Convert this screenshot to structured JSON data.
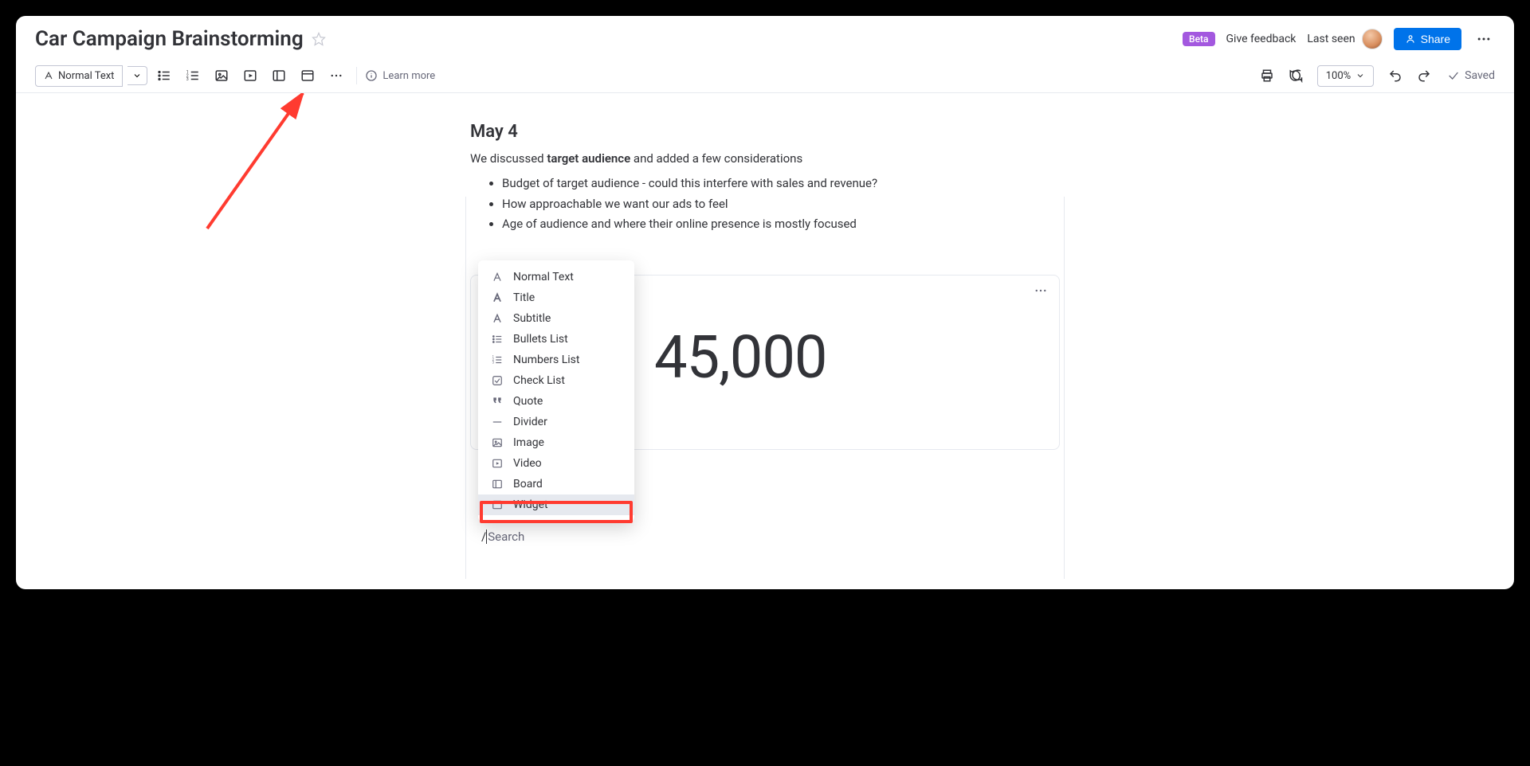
{
  "header": {
    "title": "Car Campaign Brainstorming",
    "beta_label": "Beta",
    "give_feedback": "Give feedback",
    "last_seen": "Last seen",
    "share_label": "Share"
  },
  "toolbar": {
    "text_style": "Normal Text",
    "learn_more": "Learn more",
    "zoom": "100%",
    "saved": "Saved"
  },
  "doc": {
    "date_heading": "May 4",
    "intro_prefix": "We discussed ",
    "intro_bold": "target audience",
    "intro_suffix": " and added a few considerations",
    "bullets": [
      "Budget of target audience - could this interfere with sales and revenue?",
      "How approachable we want our ads to feel",
      "Age of audience and where their online presence is mostly focused"
    ],
    "widget_value": "45,000"
  },
  "block_menu": {
    "items": [
      "Normal Text",
      "Title",
      "Subtitle",
      "Bullets List",
      "Numbers List",
      "Check List",
      "Quote",
      "Divider",
      "Image",
      "Video",
      "Board",
      "Widget"
    ],
    "selected_index": 11,
    "search_placeholder": "Search"
  }
}
